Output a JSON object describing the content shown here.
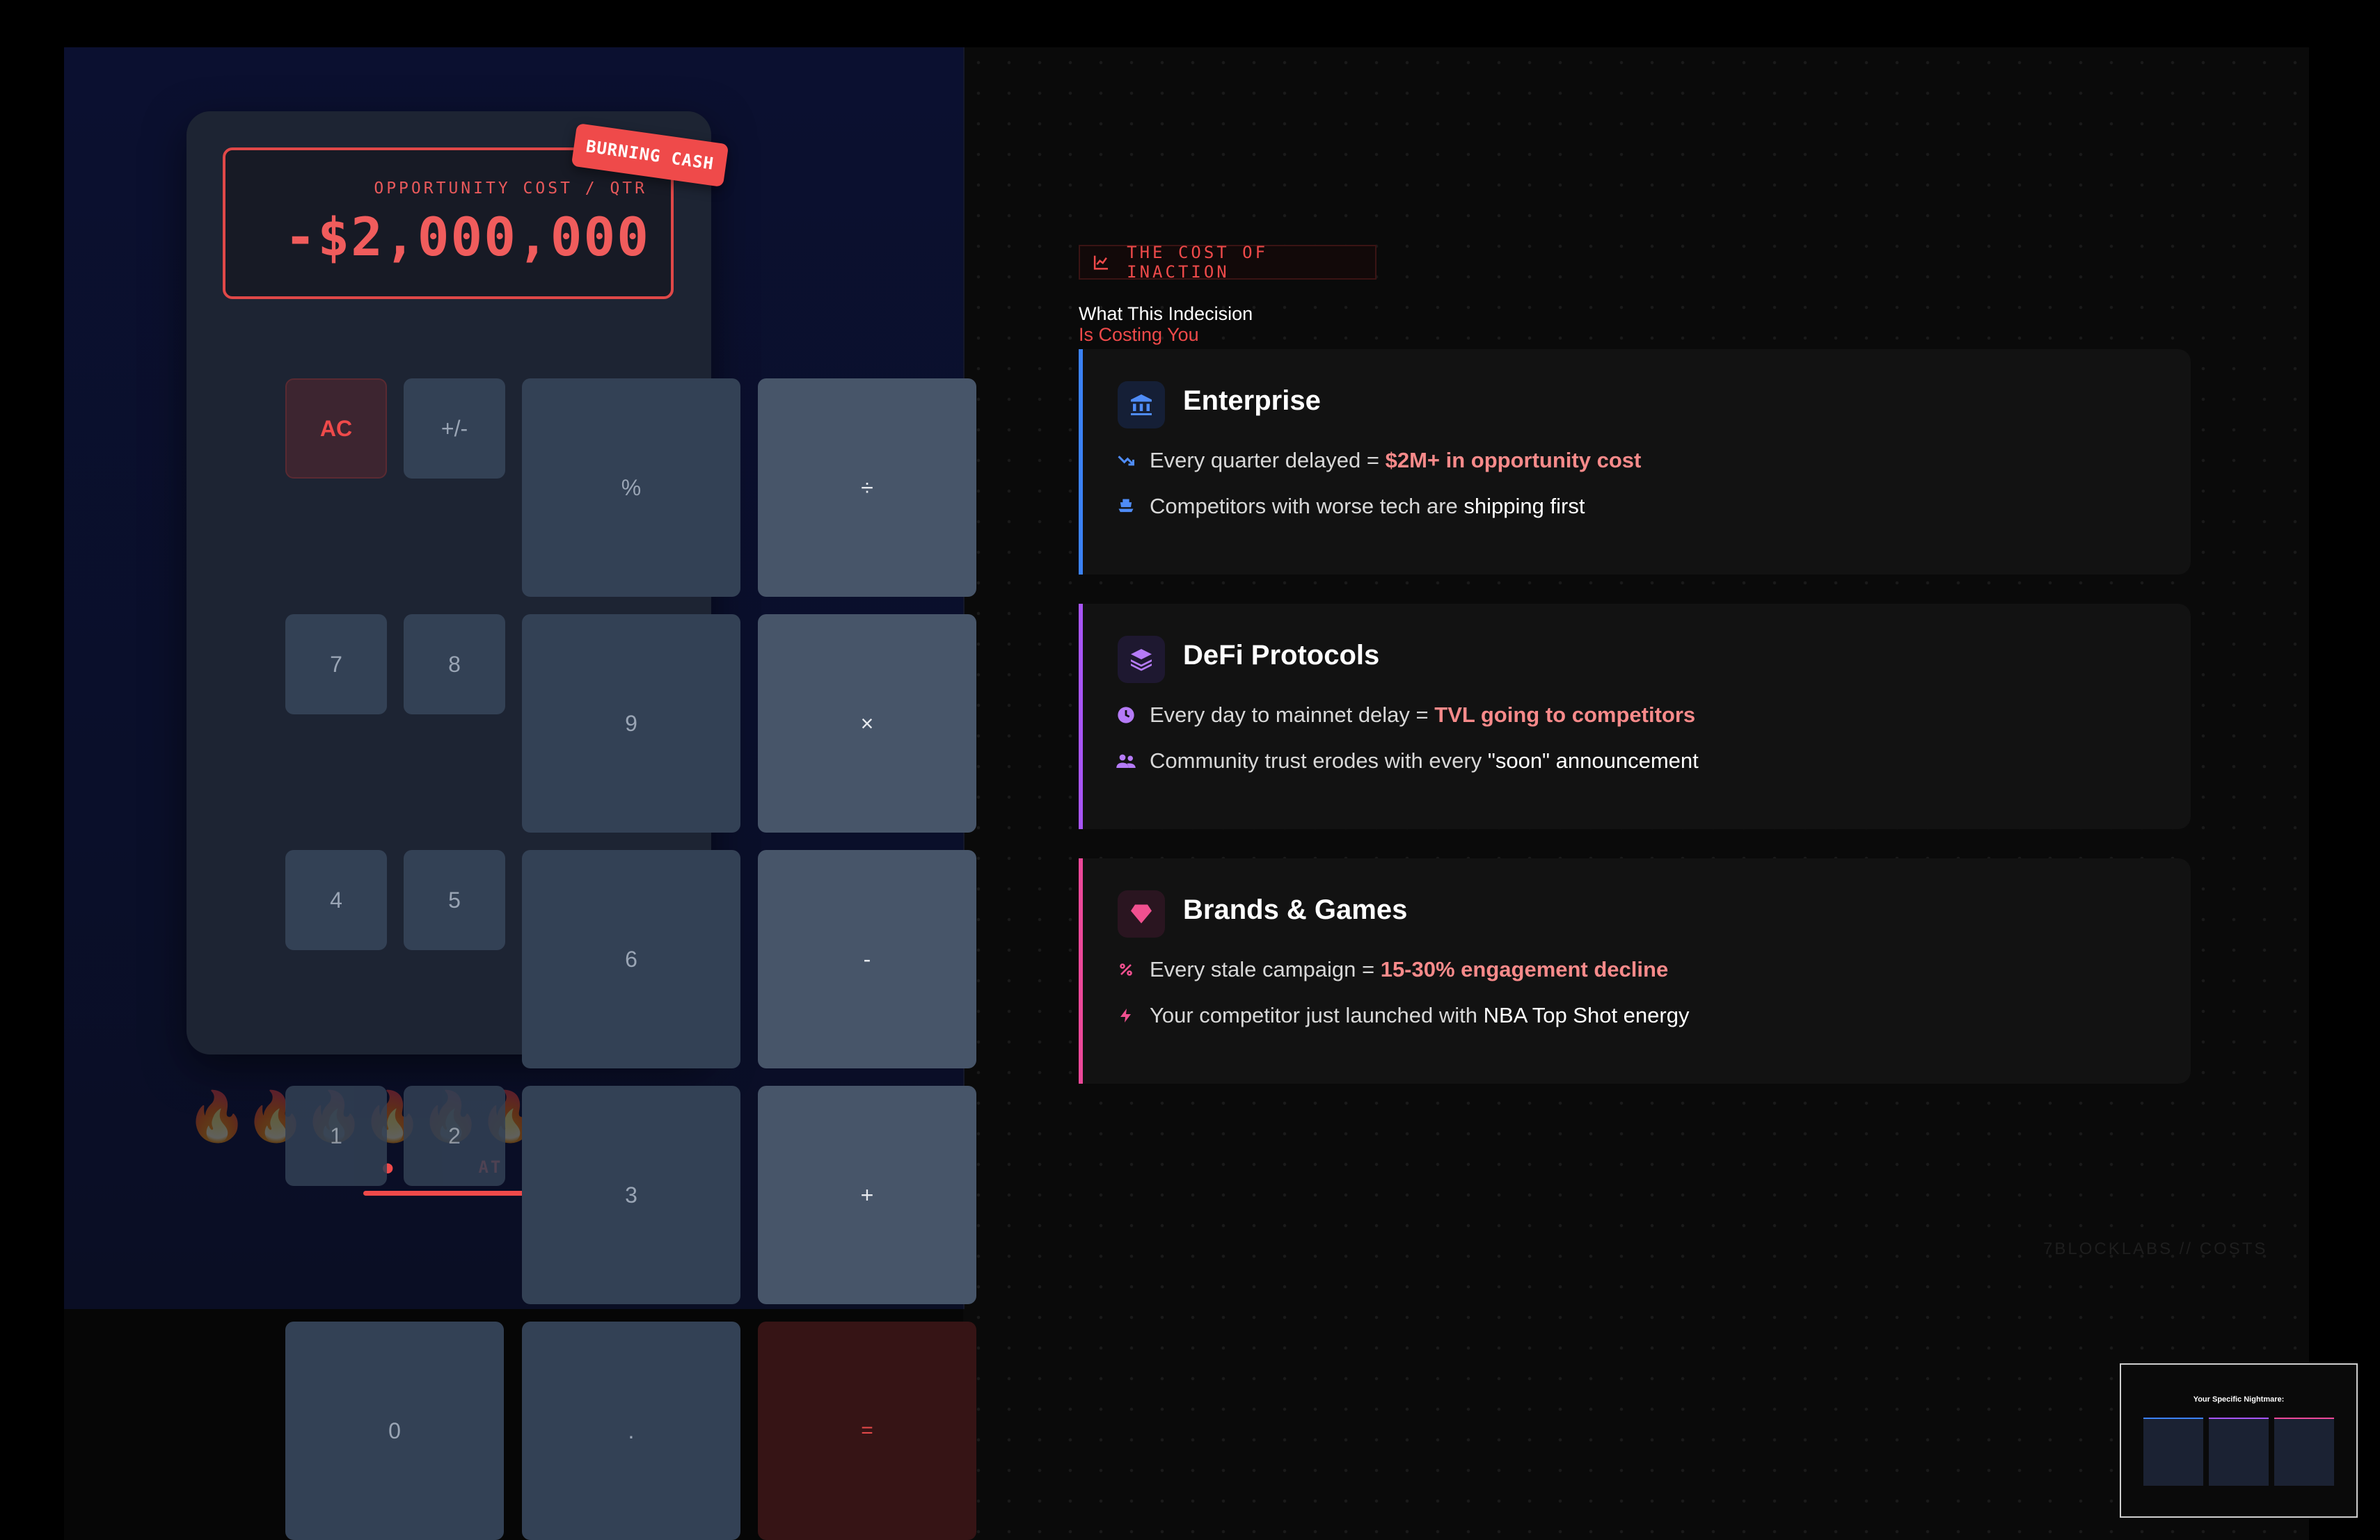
{
  "calculator": {
    "badge": "BURNING CASH",
    "display_label": "OPPORTUNITY COST / QTR",
    "display_value": "-$2,000,000",
    "keys": {
      "ac": "AC",
      "sign": "+/-",
      "percent": "%",
      "divide": "÷",
      "k7": "7",
      "k8": "8",
      "k9": "9",
      "multiply": "×",
      "k4": "4",
      "k5": "5",
      "k6": "6",
      "minus": "-",
      "k1": "1",
      "k2": "2",
      "k3": "3",
      "plus": "+",
      "k0": "0",
      "dot": ".",
      "equals": "="
    },
    "burn_label": "AT"
  },
  "content": {
    "tag": "THE COST OF INACTION",
    "heading_line1": "What This Indecision",
    "heading_line2": "Is Costing You",
    "cards": [
      {
        "title": "Enterprise",
        "accent": "#3b82f6",
        "icon": "bank-icon",
        "rows": [
          {
            "icon": "trend-down-icon",
            "text": "Every quarter delayed = ",
            "highlight": "$2M+ in opportunity cost"
          },
          {
            "icon": "ship-icon",
            "text": "Competitors with worse tech are ",
            "white": "shipping first"
          }
        ]
      },
      {
        "title": "DeFi Protocols",
        "accent": "#a855f7",
        "icon": "layers-icon",
        "rows": [
          {
            "icon": "clock-icon",
            "text": "Every day to mainnet delay = ",
            "highlight": "TVL going to competitors"
          },
          {
            "icon": "users-icon",
            "text": "Community trust erodes with every ",
            "white": "\"soon\" announcement"
          }
        ]
      },
      {
        "title": "Brands & Games",
        "accent": "#ec4899",
        "icon": "gem-icon",
        "rows": [
          {
            "icon": "percent-icon",
            "text": "Every stale campaign = ",
            "highlight": "15-30% engagement decline"
          },
          {
            "icon": "bolt-icon",
            "text": "Your competitor just launched with ",
            "white": "NBA Top Shot energy"
          }
        ]
      }
    ],
    "footer": "7BLOCKLABS // COSTS"
  },
  "thumbnail": {
    "title": "Your Specific Nightmare:"
  }
}
